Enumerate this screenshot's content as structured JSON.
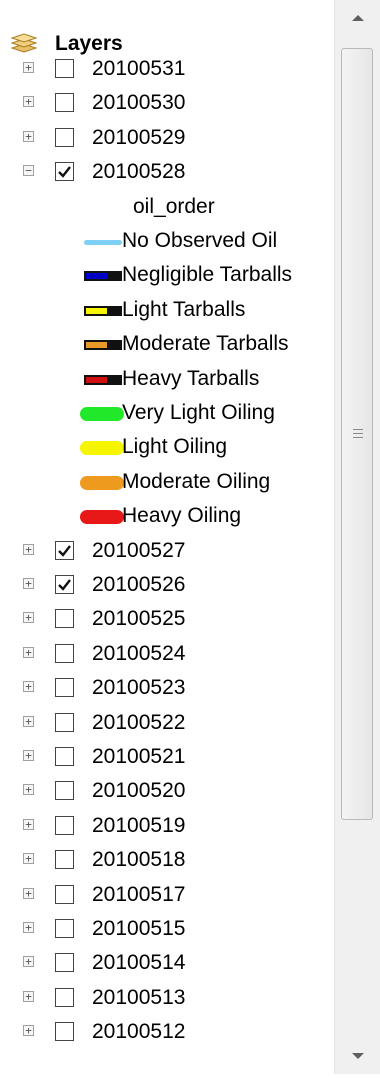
{
  "header": {
    "title": "Layers"
  },
  "layers_before": [
    {
      "name": "20100531",
      "checked": false,
      "expanded": false
    },
    {
      "name": "20100530",
      "checked": false,
      "expanded": false
    },
    {
      "name": "20100529",
      "checked": false,
      "expanded": false
    }
  ],
  "expanded_layer": {
    "name": "20100528",
    "checked": true,
    "expanded": true,
    "field": "oil_order",
    "legend": [
      {
        "label": "No Observed Oil",
        "style": "line-thin",
        "color": "#7fd0f5"
      },
      {
        "label": "Negligible Tarballs",
        "style": "box",
        "color": "#0000c8"
      },
      {
        "label": "Light Tarballs",
        "style": "box",
        "color": "#f5f500"
      },
      {
        "label": "Moderate Tarballs",
        "style": "box",
        "color": "#e89a28"
      },
      {
        "label": "Heavy Tarballs",
        "style": "box",
        "color": "#d01010"
      },
      {
        "label": "Very Light Oiling",
        "style": "line-thick",
        "color": "#22e82a"
      },
      {
        "label": "Light Oiling",
        "style": "line-thick",
        "color": "#f5f500"
      },
      {
        "label": "Moderate Oiling",
        "style": "line-thick",
        "color": "#ee9a1e"
      },
      {
        "label": "Heavy Oiling",
        "style": "line-thick",
        "color": "#e81818"
      }
    ]
  },
  "layers_after": [
    {
      "name": "20100527",
      "checked": true,
      "expanded": false
    },
    {
      "name": "20100526",
      "checked": true,
      "expanded": false
    },
    {
      "name": "20100525",
      "checked": false,
      "expanded": false
    },
    {
      "name": "20100524",
      "checked": false,
      "expanded": false
    },
    {
      "name": "20100523",
      "checked": false,
      "expanded": false
    },
    {
      "name": "20100522",
      "checked": false,
      "expanded": false
    },
    {
      "name": "20100521",
      "checked": false,
      "expanded": false
    },
    {
      "name": "20100520",
      "checked": false,
      "expanded": false
    },
    {
      "name": "20100519",
      "checked": false,
      "expanded": false
    },
    {
      "name": "20100518",
      "checked": false,
      "expanded": false
    },
    {
      "name": "20100517",
      "checked": false,
      "expanded": false
    },
    {
      "name": "20100515",
      "checked": false,
      "expanded": false
    },
    {
      "name": "20100514",
      "checked": false,
      "expanded": false
    },
    {
      "name": "20100513",
      "checked": false,
      "expanded": false
    },
    {
      "name": "20100512",
      "checked": false,
      "expanded": false
    }
  ]
}
